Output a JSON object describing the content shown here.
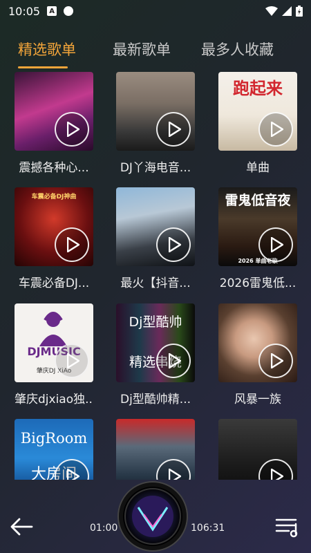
{
  "status": {
    "time": "10:05",
    "badge": "A"
  },
  "tabs": [
    {
      "label": "精选歌单",
      "active": true
    },
    {
      "label": "最新歌单",
      "active": false
    },
    {
      "label": "最多人收藏",
      "active": false
    }
  ],
  "playlists": [
    {
      "title": "震撼各种心...",
      "overlay": ""
    },
    {
      "title": "DJ丫海电音...",
      "overlay": ""
    },
    {
      "title": "单曲",
      "overlay": "跑起来"
    },
    {
      "title": "车震必备DJ...",
      "overlay": "车震必备DJ神曲"
    },
    {
      "title": "最火【抖音...",
      "overlay": ""
    },
    {
      "title": "2026雷鬼低...",
      "overlay": "雷鬼低音夜",
      "overlay_sub": "2026 单曲老歌"
    },
    {
      "title": "肇庆djxiao独...",
      "overlay": "DJMUSIC",
      "overlay_sub": "肇庆DJ XiAo"
    },
    {
      "title": "Dj型酷帅精...",
      "overlay": "Dj型酷帅",
      "overlay_sub": "精选串烧"
    },
    {
      "title": "风暴一族",
      "overlay": ""
    },
    {
      "title": "",
      "overlay": "BigRoom",
      "overlay_sub": "大房间"
    },
    {
      "title": "",
      "overlay": ""
    },
    {
      "title": "",
      "overlay": ""
    }
  ],
  "player": {
    "current_time": "01:00",
    "total_time": "106:31",
    "icons": {
      "back": "arrow-left-icon",
      "playlist": "playlist-icon",
      "play": "play-icon"
    }
  }
}
